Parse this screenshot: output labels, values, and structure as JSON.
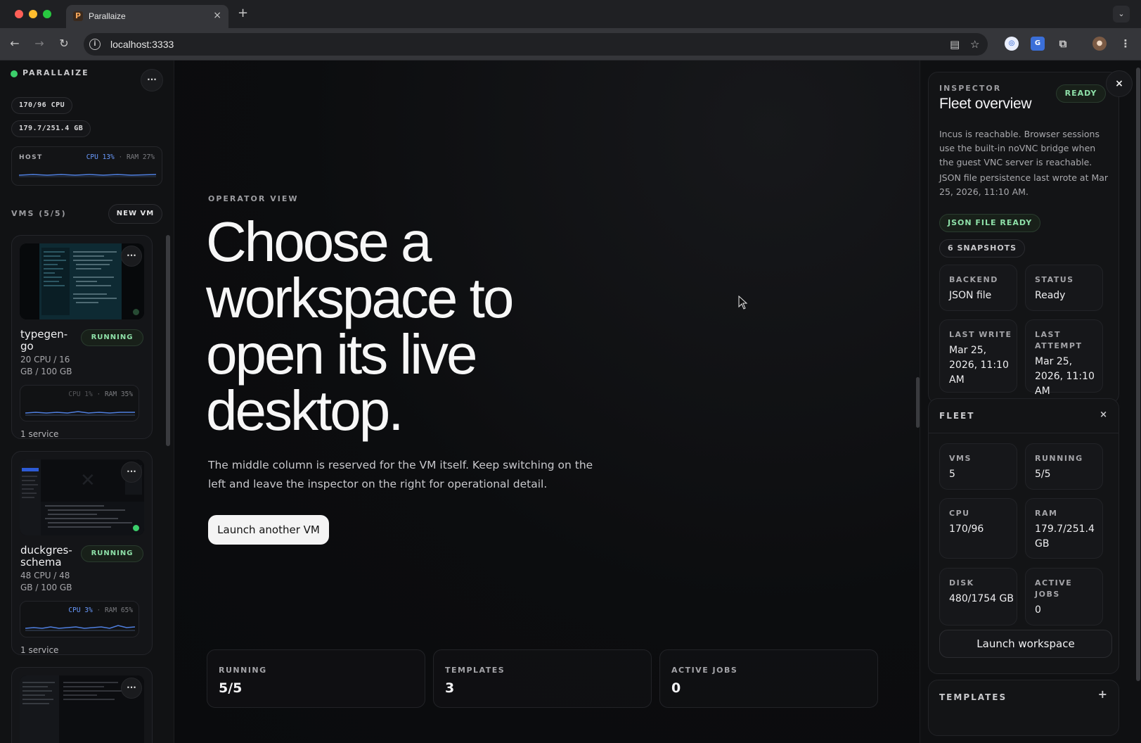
{
  "browser": {
    "tab_title": "Parallaize",
    "favicon_letter": "P",
    "close_glyph": "×",
    "new_tab_glyph": "+",
    "menu_glyph": "⌄",
    "url": "localhost:3333"
  },
  "sidebar": {
    "brand": "PARALLAIZE",
    "menu_label": "···",
    "pills": [
      "170/96 CPU",
      "179.7/251.4 GB"
    ],
    "host": {
      "label": "HOST",
      "cpu": "CPU 13%",
      "separator": "·",
      "ram": "RAM 27%"
    },
    "vms_heading": "VMS (5/5)",
    "new_vm_label": "NEW VM",
    "vms": [
      {
        "name": "typegen-go",
        "status": "RUNNING",
        "spec": "20 CPU / 16 GB / 100 GB",
        "cpu": "CPU 1%",
        "separator": "·",
        "ram": "RAM 35%",
        "services": "1 service",
        "menu": "···"
      },
      {
        "name": "duckgres-schema",
        "status": "RUNNING",
        "spec": "48 CPU / 48 GB / 100 GB",
        "cpu": "CPU 3%",
        "separator": "·",
        "ram": "RAM 65%",
        "services": "1 service",
        "menu": "···"
      },
      {
        "menu": "···"
      }
    ]
  },
  "main": {
    "eyebrow": "OPERATOR VIEW",
    "headline": "Choose a workspace to open its live desktop.",
    "subtitle": "The middle column is reserved for the VM itself. Keep switching on the left and leave the inspector on the right for operational detail.",
    "launch_label": "Launch another VM",
    "stats": [
      {
        "label": "RUNNING",
        "value": "5/5"
      },
      {
        "label": "TEMPLATES",
        "value": "3"
      },
      {
        "label": "ACTIVE JOBS",
        "value": "0"
      }
    ]
  },
  "inspector": {
    "eyebrow": "INSPECTOR",
    "title": "Fleet overview",
    "badge": "READY",
    "close_glyph": "×",
    "paragraph1": "Incus is reachable. Browser sessions use the built-in noVNC bridge when the guest VNC server is reachable.",
    "paragraph2": "JSON file persistence last wrote at Mar 25, 2026, 11:10 AM.",
    "persistence_pill": "JSON FILE READY",
    "snapshots_pill": "6 SNAPSHOTS",
    "details": [
      {
        "label": "BACKEND",
        "value": "JSON file"
      },
      {
        "label": "STATUS",
        "value": "Ready"
      },
      {
        "label": "LAST WRITE",
        "value": "Mar 25, 2026, 11:10 AM"
      },
      {
        "label": "LAST ATTEMPT",
        "value": "Mar 25, 2026, 11:10 AM"
      }
    ],
    "fleet": {
      "title": "FLEET",
      "close_glyph": "×",
      "items": [
        {
          "label": "VMS",
          "value": "5"
        },
        {
          "label": "RUNNING",
          "value": "5/5"
        },
        {
          "label": "CPU",
          "value": "170/96"
        },
        {
          "label": "RAM",
          "value": "179.7/251.4 GB"
        },
        {
          "label": "DISK",
          "value": "480/1754 GB"
        },
        {
          "label": "ACTIVE JOBS",
          "value": "0"
        }
      ],
      "launch_label": "Launch workspace"
    },
    "templates": {
      "title": "TEMPLATES",
      "add_glyph": "+"
    }
  },
  "colors": {
    "accent_green": "#3ccf6b",
    "cpu_blue": "#6a9bff",
    "badge_green": "#8ee0a8"
  }
}
